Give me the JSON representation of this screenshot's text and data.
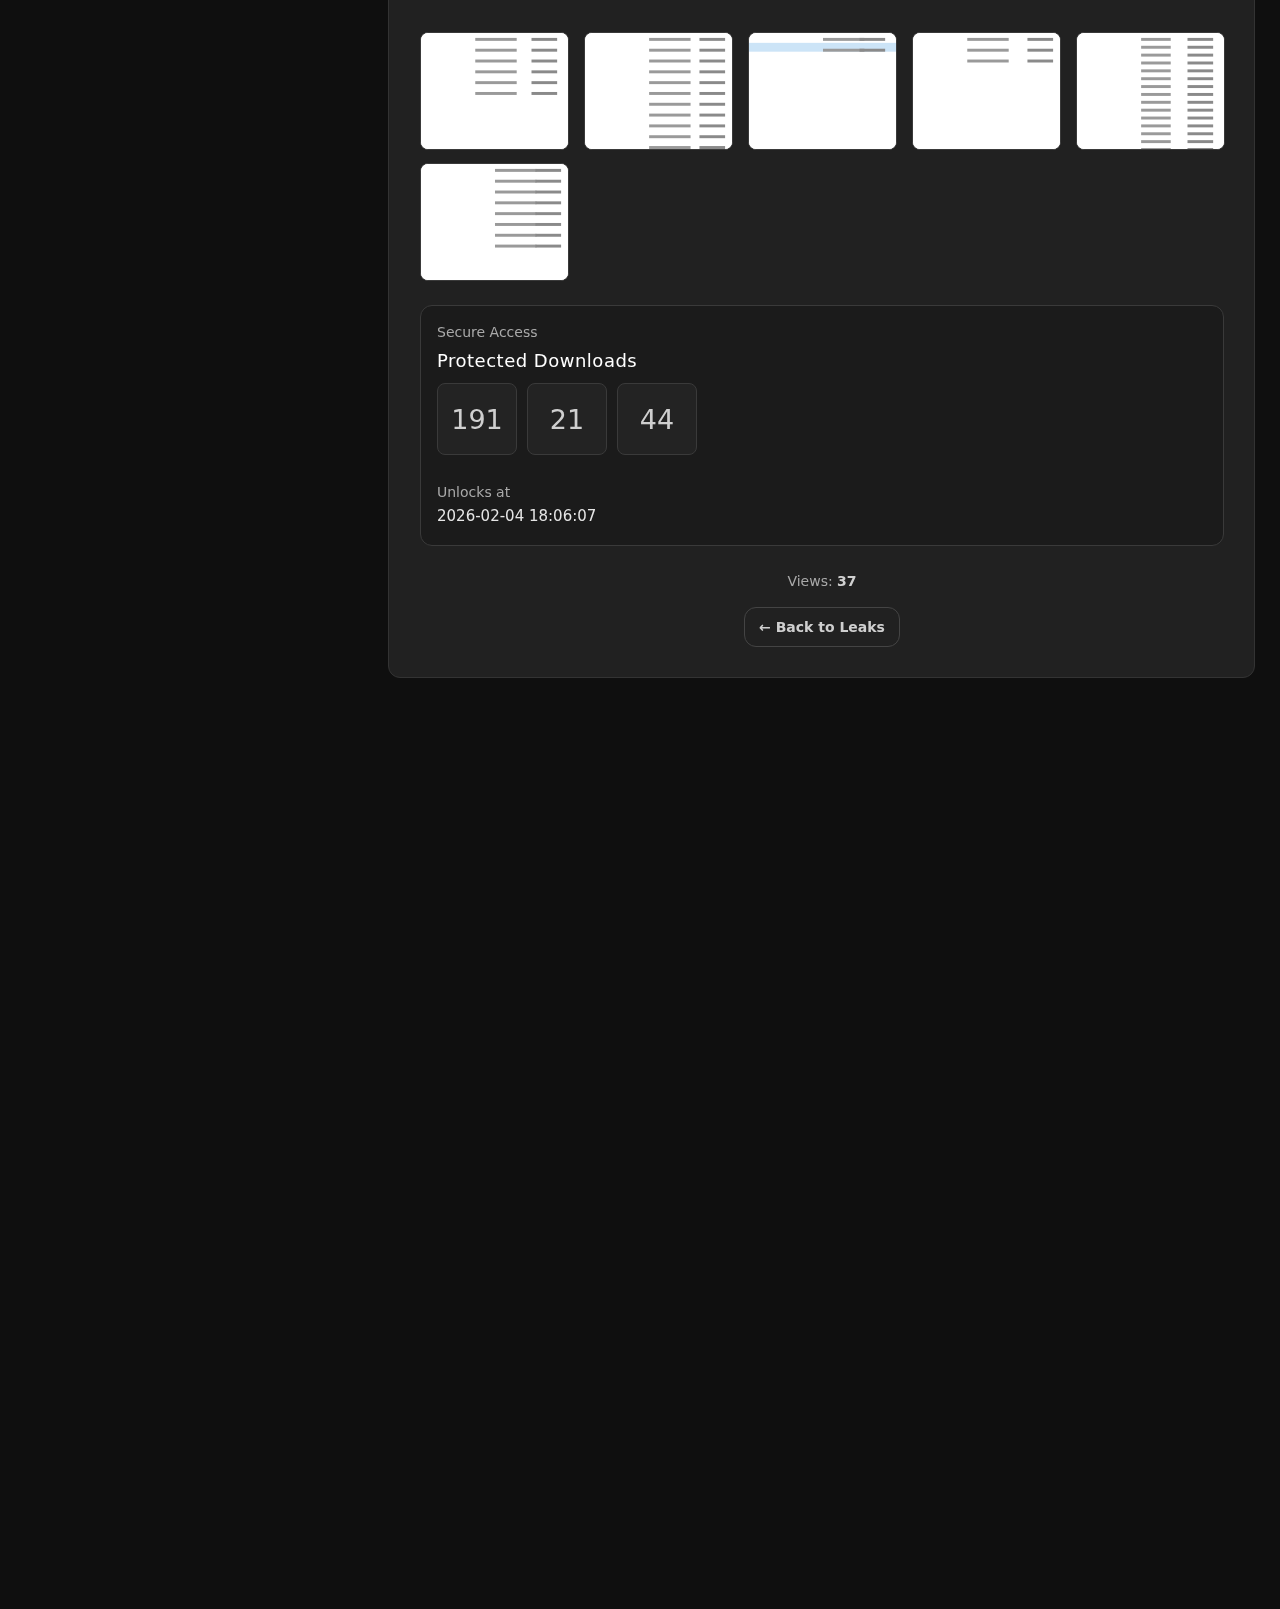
{
  "secure_access": {
    "label": "Secure Access",
    "title": "Protected Downloads",
    "countdown": [
      "191",
      "21",
      "44"
    ],
    "unlocks_label": "Unlocks at",
    "unlocks_at": "2026-02-04 18:06:07"
  },
  "views": "Views: **37**",
  "back_button": "← Back to Leaks"
}
